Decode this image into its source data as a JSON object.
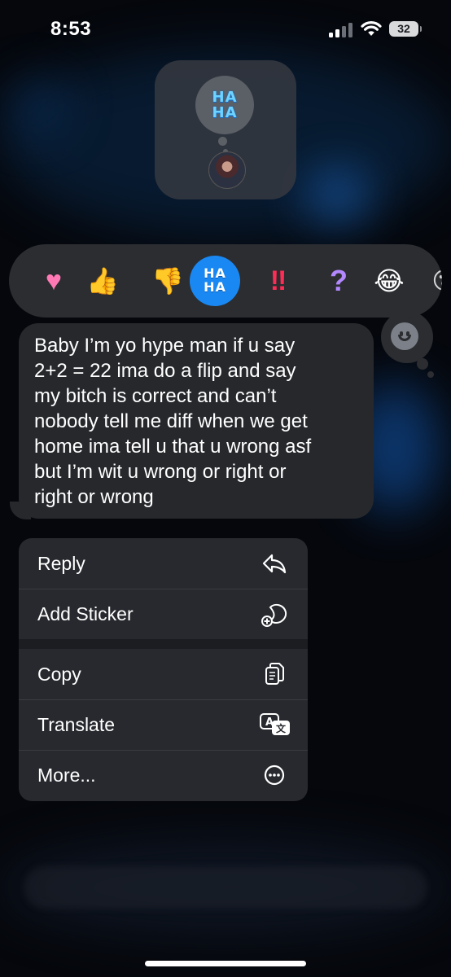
{
  "status_bar": {
    "time": "8:53",
    "battery": "32",
    "icons": [
      "cellular-signal-icon",
      "wifi-icon",
      "battery-icon"
    ]
  },
  "reactor": {
    "reaction_label": "HA HA",
    "reaction_line1": "HA",
    "reaction_line2": "HA"
  },
  "tapbacks": [
    {
      "name": "heart",
      "glyph": "♥"
    },
    {
      "name": "thumbs-up",
      "glyph": "👍"
    },
    {
      "name": "thumbs-down",
      "glyph": "👎"
    },
    {
      "name": "haha",
      "glyph": "HA HA",
      "selected": true
    },
    {
      "name": "emphasize",
      "glyph": "‼"
    },
    {
      "name": "question",
      "glyph": "?"
    },
    {
      "name": "laughing-emoji",
      "glyph": "😂"
    },
    {
      "name": "more-emoji-partial",
      "glyph": "😮"
    }
  ],
  "message": {
    "text": "Baby I’m yo hype man if u say\n2+2 = 22 ima do a flip and say\nmy bitch is correct and can’t\nnobody tell me diff when we get\nhome ima tell u that u wrong asf\nbut I’m wit u wrong or right or\nright or wrong"
  },
  "menu": {
    "reply": "Reply",
    "add_sticker": "Add Sticker",
    "copy": "Copy",
    "translate": "Translate",
    "more": "More..."
  },
  "colors": {
    "accent": "#1a88f2",
    "bubble": "#26282c",
    "menu": "#27292e"
  }
}
